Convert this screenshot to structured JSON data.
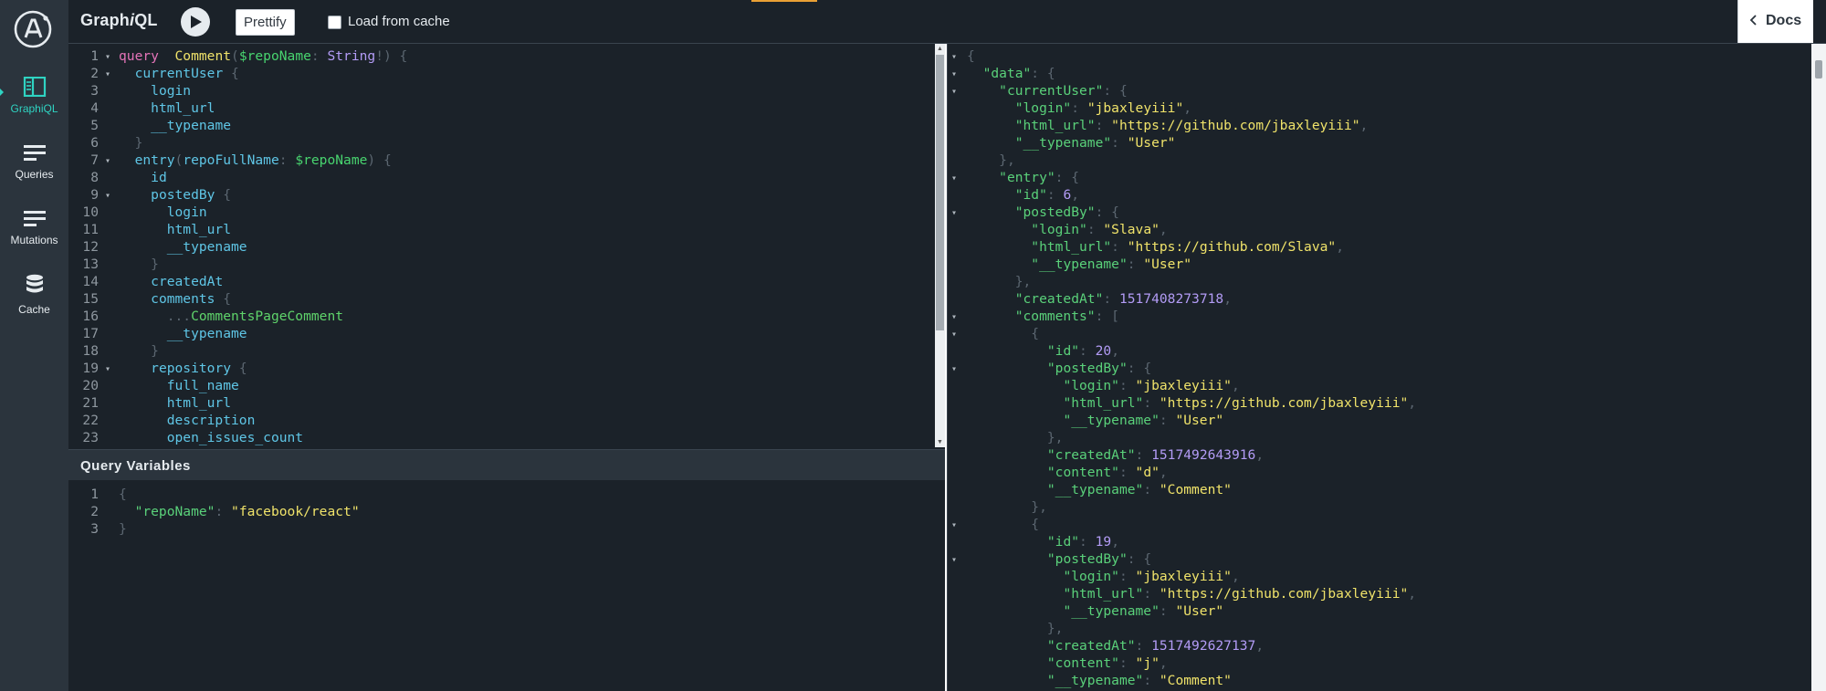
{
  "app": {
    "title_prefix": "Graph",
    "title_italic": "i",
    "title_suffix": "QL"
  },
  "sidebar": {
    "items": [
      {
        "label": "GraphiQL",
        "icon": "graphiql-icon",
        "active": true
      },
      {
        "label": "Queries",
        "icon": "queries-icon"
      },
      {
        "label": "Mutations",
        "icon": "mutations-icon"
      },
      {
        "label": "Cache",
        "icon": "database-icon"
      }
    ]
  },
  "toolbar": {
    "prettify_label": "Prettify",
    "cache_label": "Load from cache",
    "docs_label": "Docs"
  },
  "query_editor": {
    "lines": [
      {
        "n": "1",
        "fold": true,
        "tokens": [
          [
            "kw",
            "query"
          ],
          [
            "",
            "  "
          ],
          [
            "def",
            "Comment"
          ],
          [
            "punct",
            "("
          ],
          [
            "var",
            "$repoName"
          ],
          [
            "punct",
            ": "
          ],
          [
            "type",
            "String"
          ],
          [
            "punct",
            "!) {"
          ]
        ]
      },
      {
        "n": "2",
        "fold": true,
        "tokens": [
          [
            "",
            "  "
          ],
          [
            "field",
            "currentUser"
          ],
          [
            "punct",
            " {"
          ]
        ]
      },
      {
        "n": "3",
        "tokens": [
          [
            "",
            "    "
          ],
          [
            "field",
            "login"
          ]
        ]
      },
      {
        "n": "4",
        "tokens": [
          [
            "",
            "    "
          ],
          [
            "field",
            "html_url"
          ]
        ]
      },
      {
        "n": "5",
        "tokens": [
          [
            "",
            "    "
          ],
          [
            "field",
            "__typename"
          ]
        ]
      },
      {
        "n": "6",
        "tokens": [
          [
            "",
            "  "
          ],
          [
            "punct",
            "}"
          ]
        ]
      },
      {
        "n": "7",
        "fold": true,
        "tokens": [
          [
            "",
            "  "
          ],
          [
            "field",
            "entry"
          ],
          [
            "punct",
            "("
          ],
          [
            "field",
            "repoFullName"
          ],
          [
            "punct",
            ": "
          ],
          [
            "var",
            "$repoName"
          ],
          [
            "punct",
            ") {"
          ]
        ]
      },
      {
        "n": "8",
        "tokens": [
          [
            "",
            "    "
          ],
          [
            "field",
            "id"
          ]
        ]
      },
      {
        "n": "9",
        "fold": true,
        "tokens": [
          [
            "",
            "    "
          ],
          [
            "field",
            "postedBy"
          ],
          [
            "punct",
            " {"
          ]
        ]
      },
      {
        "n": "10",
        "tokens": [
          [
            "",
            "      "
          ],
          [
            "field",
            "login"
          ]
        ]
      },
      {
        "n": "11",
        "tokens": [
          [
            "",
            "      "
          ],
          [
            "field",
            "html_url"
          ]
        ]
      },
      {
        "n": "12",
        "tokens": [
          [
            "",
            "      "
          ],
          [
            "field",
            "__typename"
          ]
        ]
      },
      {
        "n": "13",
        "tokens": [
          [
            "",
            "    "
          ],
          [
            "punct",
            "}"
          ]
        ]
      },
      {
        "n": "14",
        "tokens": [
          [
            "",
            "    "
          ],
          [
            "field",
            "createdAt"
          ]
        ]
      },
      {
        "n": "15",
        "tokens": [
          [
            "",
            "    "
          ],
          [
            "field",
            "comments"
          ],
          [
            "punct",
            " {"
          ]
        ]
      },
      {
        "n": "16",
        "tokens": [
          [
            "",
            "      "
          ],
          [
            "punct",
            "..."
          ],
          [
            "frag",
            "CommentsPageComment"
          ]
        ]
      },
      {
        "n": "17",
        "tokens": [
          [
            "",
            "      "
          ],
          [
            "field",
            "__typename"
          ]
        ]
      },
      {
        "n": "18",
        "tokens": [
          [
            "",
            "    "
          ],
          [
            "punct",
            "}"
          ]
        ]
      },
      {
        "n": "19",
        "fold": true,
        "tokens": [
          [
            "",
            "    "
          ],
          [
            "field",
            "repository"
          ],
          [
            "punct",
            " {"
          ]
        ]
      },
      {
        "n": "20",
        "tokens": [
          [
            "",
            "      "
          ],
          [
            "field",
            "full_name"
          ]
        ]
      },
      {
        "n": "21",
        "tokens": [
          [
            "",
            "      "
          ],
          [
            "field",
            "html_url"
          ]
        ]
      },
      {
        "n": "22",
        "tokens": [
          [
            "",
            "      "
          ],
          [
            "field",
            "description"
          ]
        ]
      },
      {
        "n": "23",
        "tokens": [
          [
            "",
            "      "
          ],
          [
            "field",
            "open_issues_count"
          ]
        ]
      }
    ]
  },
  "variables": {
    "title": "Query Variables",
    "lines": [
      {
        "n": "1",
        "tokens": [
          [
            "punct",
            "{"
          ]
        ]
      },
      {
        "n": "2",
        "tokens": [
          [
            "",
            "  "
          ],
          [
            "key",
            "\"repoName\""
          ],
          [
            "punct",
            ": "
          ],
          [
            "str",
            "\"facebook/react\""
          ]
        ]
      },
      {
        "n": "3",
        "tokens": [
          [
            "punct",
            "}"
          ]
        ]
      }
    ]
  },
  "result": {
    "lines": [
      {
        "fold": true,
        "tokens": [
          [
            "punct",
            "{"
          ]
        ]
      },
      {
        "fold": true,
        "tokens": [
          [
            "",
            "  "
          ],
          [
            "key",
            "\"data\""
          ],
          [
            "punct",
            ": {"
          ]
        ]
      },
      {
        "fold": true,
        "tokens": [
          [
            "",
            "    "
          ],
          [
            "key",
            "\"currentUser\""
          ],
          [
            "punct",
            ": {"
          ]
        ]
      },
      {
        "tokens": [
          [
            "",
            "      "
          ],
          [
            "key",
            "\"login\""
          ],
          [
            "punct",
            ": "
          ],
          [
            "str",
            "\"jbaxleyiii\""
          ],
          [
            "punct",
            ","
          ]
        ]
      },
      {
        "tokens": [
          [
            "",
            "      "
          ],
          [
            "key",
            "\"html_url\""
          ],
          [
            "punct",
            ": "
          ],
          [
            "str",
            "\"https://github.com/jbaxleyiii\""
          ],
          [
            "punct",
            ","
          ]
        ]
      },
      {
        "tokens": [
          [
            "",
            "      "
          ],
          [
            "key",
            "\"__typename\""
          ],
          [
            "punct",
            ": "
          ],
          [
            "str",
            "\"User\""
          ]
        ]
      },
      {
        "tokens": [
          [
            "",
            "    "
          ],
          [
            "punct",
            "},"
          ]
        ]
      },
      {
        "fold": true,
        "tokens": [
          [
            "",
            "    "
          ],
          [
            "key",
            "\"entry\""
          ],
          [
            "punct",
            ": {"
          ]
        ]
      },
      {
        "tokens": [
          [
            "",
            "      "
          ],
          [
            "key",
            "\"id\""
          ],
          [
            "punct",
            ": "
          ],
          [
            "num",
            "6"
          ],
          [
            "punct",
            ","
          ]
        ]
      },
      {
        "fold": true,
        "tokens": [
          [
            "",
            "      "
          ],
          [
            "key",
            "\"postedBy\""
          ],
          [
            "punct",
            ": {"
          ]
        ]
      },
      {
        "tokens": [
          [
            "",
            "        "
          ],
          [
            "key",
            "\"login\""
          ],
          [
            "punct",
            ": "
          ],
          [
            "str",
            "\"Slava\""
          ],
          [
            "punct",
            ","
          ]
        ]
      },
      {
        "tokens": [
          [
            "",
            "        "
          ],
          [
            "key",
            "\"html_url\""
          ],
          [
            "punct",
            ": "
          ],
          [
            "str",
            "\"https://github.com/Slava\""
          ],
          [
            "punct",
            ","
          ]
        ]
      },
      {
        "tokens": [
          [
            "",
            "        "
          ],
          [
            "key",
            "\"__typename\""
          ],
          [
            "punct",
            ": "
          ],
          [
            "str",
            "\"User\""
          ]
        ]
      },
      {
        "tokens": [
          [
            "",
            "      "
          ],
          [
            "punct",
            "},"
          ]
        ]
      },
      {
        "tokens": [
          [
            "",
            "      "
          ],
          [
            "key",
            "\"createdAt\""
          ],
          [
            "punct",
            ": "
          ],
          [
            "num",
            "1517408273718"
          ],
          [
            "punct",
            ","
          ]
        ]
      },
      {
        "fold": true,
        "tokens": [
          [
            "",
            "      "
          ],
          [
            "key",
            "\"comments\""
          ],
          [
            "punct",
            ": ["
          ]
        ]
      },
      {
        "fold": true,
        "tokens": [
          [
            "",
            "        "
          ],
          [
            "punct",
            "{"
          ]
        ]
      },
      {
        "tokens": [
          [
            "",
            "          "
          ],
          [
            "key",
            "\"id\""
          ],
          [
            "punct",
            ": "
          ],
          [
            "num",
            "20"
          ],
          [
            "punct",
            ","
          ]
        ]
      },
      {
        "fold": true,
        "tokens": [
          [
            "",
            "          "
          ],
          [
            "key",
            "\"postedBy\""
          ],
          [
            "punct",
            ": {"
          ]
        ]
      },
      {
        "tokens": [
          [
            "",
            "            "
          ],
          [
            "key",
            "\"login\""
          ],
          [
            "punct",
            ": "
          ],
          [
            "str",
            "\"jbaxleyiii\""
          ],
          [
            "punct",
            ","
          ]
        ]
      },
      {
        "tokens": [
          [
            "",
            "            "
          ],
          [
            "key",
            "\"html_url\""
          ],
          [
            "punct",
            ": "
          ],
          [
            "str",
            "\"https://github.com/jbaxleyiii\""
          ],
          [
            "punct",
            ","
          ]
        ]
      },
      {
        "tokens": [
          [
            "",
            "            "
          ],
          [
            "key",
            "\"__typename\""
          ],
          [
            "punct",
            ": "
          ],
          [
            "str",
            "\"User\""
          ]
        ]
      },
      {
        "tokens": [
          [
            "",
            "          "
          ],
          [
            "punct",
            "},"
          ]
        ]
      },
      {
        "tokens": [
          [
            "",
            "          "
          ],
          [
            "key",
            "\"createdAt\""
          ],
          [
            "punct",
            ": "
          ],
          [
            "num",
            "1517492643916"
          ],
          [
            "punct",
            ","
          ]
        ]
      },
      {
        "tokens": [
          [
            "",
            "          "
          ],
          [
            "key",
            "\"content\""
          ],
          [
            "punct",
            ": "
          ],
          [
            "str",
            "\"d\""
          ],
          [
            "punct",
            ","
          ]
        ]
      },
      {
        "tokens": [
          [
            "",
            "          "
          ],
          [
            "key",
            "\"__typename\""
          ],
          [
            "punct",
            ": "
          ],
          [
            "str",
            "\"Comment\""
          ]
        ]
      },
      {
        "tokens": [
          [
            "",
            "        "
          ],
          [
            "punct",
            "},"
          ]
        ]
      },
      {
        "fold": true,
        "tokens": [
          [
            "",
            "        "
          ],
          [
            "punct",
            "{"
          ]
        ]
      },
      {
        "tokens": [
          [
            "",
            "          "
          ],
          [
            "key",
            "\"id\""
          ],
          [
            "punct",
            ": "
          ],
          [
            "num",
            "19"
          ],
          [
            "punct",
            ","
          ]
        ]
      },
      {
        "fold": true,
        "tokens": [
          [
            "",
            "          "
          ],
          [
            "key",
            "\"postedBy\""
          ],
          [
            "punct",
            ": {"
          ]
        ]
      },
      {
        "tokens": [
          [
            "",
            "            "
          ],
          [
            "key",
            "\"login\""
          ],
          [
            "punct",
            ": "
          ],
          [
            "str",
            "\"jbaxleyiii\""
          ],
          [
            "punct",
            ","
          ]
        ]
      },
      {
        "tokens": [
          [
            "",
            "            "
          ],
          [
            "key",
            "\"html_url\""
          ],
          [
            "punct",
            ": "
          ],
          [
            "str",
            "\"https://github.com/jbaxleyiii\""
          ],
          [
            "punct",
            ","
          ]
        ]
      },
      {
        "tokens": [
          [
            "",
            "            "
          ],
          [
            "key",
            "\"__typename\""
          ],
          [
            "punct",
            ": "
          ],
          [
            "str",
            "\"User\""
          ]
        ]
      },
      {
        "tokens": [
          [
            "",
            "          "
          ],
          [
            "punct",
            "},"
          ]
        ]
      },
      {
        "tokens": [
          [
            "",
            "          "
          ],
          [
            "key",
            "\"createdAt\""
          ],
          [
            "punct",
            ": "
          ],
          [
            "num",
            "1517492627137"
          ],
          [
            "punct",
            ","
          ]
        ]
      },
      {
        "tokens": [
          [
            "",
            "          "
          ],
          [
            "key",
            "\"content\""
          ],
          [
            "punct",
            ": "
          ],
          [
            "str",
            "\"j\""
          ],
          [
            "punct",
            ","
          ]
        ]
      },
      {
        "tokens": [
          [
            "",
            "          "
          ],
          [
            "key",
            "\"__typename\""
          ],
          [
            "punct",
            ": "
          ],
          [
            "str",
            "\"Comment\""
          ]
        ]
      }
    ]
  }
}
